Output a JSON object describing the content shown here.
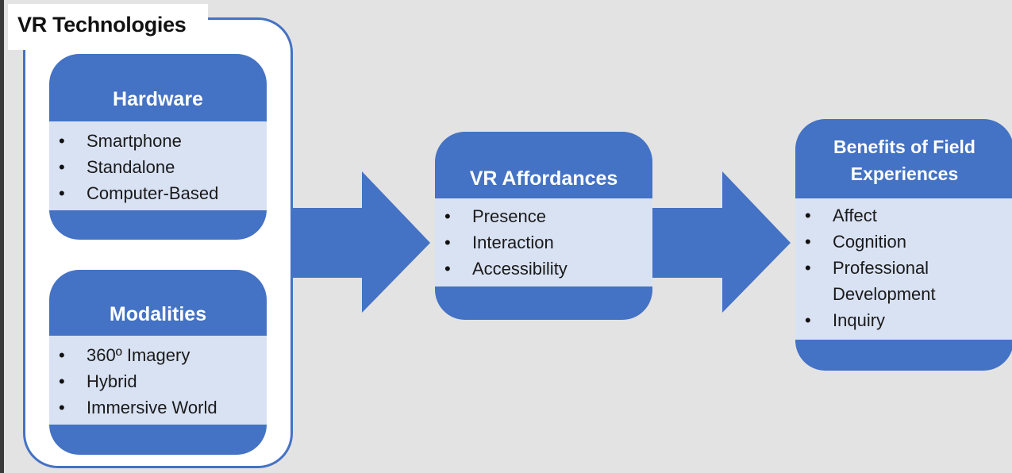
{
  "diagram": {
    "group": {
      "title": "VR Technologies",
      "cards": [
        {
          "id": "hardware",
          "title": "Hardware",
          "items": [
            "Smartphone",
            "Standalone",
            "Computer-Based"
          ]
        },
        {
          "id": "modalities",
          "title": "Modalities",
          "items": [
            "360º Imagery",
            "Hybrid",
            "Immersive World"
          ]
        }
      ]
    },
    "affordances": {
      "title": "VR Affordances",
      "items": [
        "Presence",
        "Interaction",
        "Accessibility"
      ]
    },
    "benefits": {
      "title_line1": "Benefits of Field",
      "title_line2": "Experiences",
      "items": [
        "Affect",
        "Cognition",
        "Professional",
        "Development",
        "Inquiry"
      ]
    },
    "bullet": "•",
    "flow": [
      "VR Technologies",
      "VR Affordances",
      "Benefits of Field Experiences"
    ]
  },
  "colors": {
    "background": "#e3e3e3",
    "accent": "#4472c4",
    "card_body": "#d9e2f3",
    "text": "#1a1a1a",
    "header_text": "#ffffff"
  }
}
